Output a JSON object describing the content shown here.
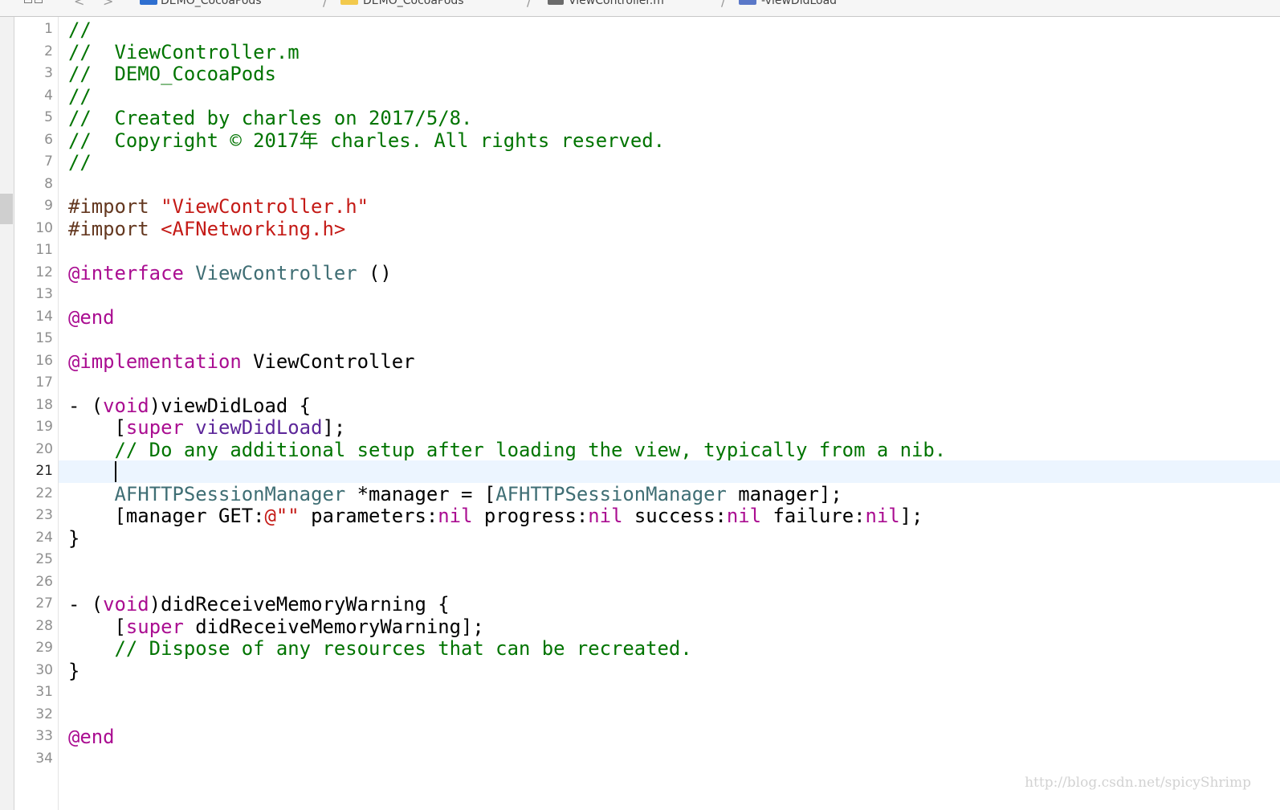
{
  "jumpbar": {
    "crumbs": [
      "DEMO_CocoaPods",
      "DEMO_CocoaPods",
      "ViewController.m",
      "-viewDidLoad"
    ],
    "separator": "/",
    "back_arrow": "<",
    "forward_arrow": ">",
    "icons": [
      "grid-icon",
      "project-file-icon",
      "folder-icon",
      "objc-source-file-icon",
      "method-icon"
    ]
  },
  "editor": {
    "filename": "ViewController.m",
    "current_line": 21,
    "colors": {
      "comment": "#007400",
      "preprocessor": "#643820",
      "string": "#c41a16",
      "keyword": "#aa0d91",
      "class": "#3f6e74",
      "library_method": "#5c2699",
      "current_line_bg": "#ecf5ff"
    },
    "line_numbers": [
      "1",
      "2",
      "3",
      "4",
      "5",
      "6",
      "7",
      "8",
      "9",
      "10",
      "11",
      "12",
      "13",
      "14",
      "15",
      "16",
      "17",
      "18",
      "19",
      "20",
      "21",
      "22",
      "23",
      "24",
      "25",
      "26",
      "27",
      "28",
      "29",
      "30",
      "31",
      "32",
      "33",
      "34"
    ],
    "lines": [
      [
        {
          "t": "comment",
          "s": "//"
        }
      ],
      [
        {
          "t": "comment",
          "s": "//  ViewController.m"
        }
      ],
      [
        {
          "t": "comment",
          "s": "//  DEMO_CocoaPods"
        }
      ],
      [
        {
          "t": "comment",
          "s": "//"
        }
      ],
      [
        {
          "t": "comment",
          "s": "//  Created by charles on 2017/5/8."
        }
      ],
      [
        {
          "t": "comment",
          "s": "//  Copyright © 2017年 charles. All rights reserved."
        }
      ],
      [
        {
          "t": "comment",
          "s": "//"
        }
      ],
      [],
      [
        {
          "t": "pre",
          "s": "#import "
        },
        {
          "t": "str",
          "s": "\"ViewController.h\""
        }
      ],
      [
        {
          "t": "pre",
          "s": "#import "
        },
        {
          "t": "str",
          "s": "<AFNetworking.h>"
        }
      ],
      [],
      [
        {
          "t": "kw",
          "s": "@interface"
        },
        {
          "t": "",
          "s": " "
        },
        {
          "t": "cls",
          "s": "ViewController"
        },
        {
          "t": "",
          "s": " ()"
        }
      ],
      [],
      [
        {
          "t": "kw",
          "s": "@end"
        }
      ],
      [],
      [
        {
          "t": "kw",
          "s": "@implementation"
        },
        {
          "t": "",
          "s": " ViewController"
        }
      ],
      [],
      [
        {
          "t": "",
          "s": "- ("
        },
        {
          "t": "kw",
          "s": "void"
        },
        {
          "t": "",
          "s": ")viewDidLoad {"
        }
      ],
      [
        {
          "t": "",
          "s": "    ["
        },
        {
          "t": "kw",
          "s": "super"
        },
        {
          "t": "",
          "s": " "
        },
        {
          "t": "lib",
          "s": "viewDidLoad"
        },
        {
          "t": "",
          "s": "];"
        }
      ],
      [
        {
          "t": "comment",
          "s": "    // Do any additional setup after loading the view, typically from a nib."
        }
      ],
      [],
      [
        {
          "t": "",
          "s": "    "
        },
        {
          "t": "cls",
          "s": "AFHTTPSessionManager"
        },
        {
          "t": "",
          "s": " *manager = ["
        },
        {
          "t": "cls",
          "s": "AFHTTPSessionManager"
        },
        {
          "t": "",
          "s": " manager];"
        }
      ],
      [
        {
          "t": "",
          "s": "    [manager GET:"
        },
        {
          "t": "str",
          "s": "@\"\""
        },
        {
          "t": "",
          "s": " parameters:"
        },
        {
          "t": "kw",
          "s": "nil"
        },
        {
          "t": "",
          "s": " progress:"
        },
        {
          "t": "kw",
          "s": "nil"
        },
        {
          "t": "",
          "s": " success:"
        },
        {
          "t": "kw",
          "s": "nil"
        },
        {
          "t": "",
          "s": " failure:"
        },
        {
          "t": "kw",
          "s": "nil"
        },
        {
          "t": "",
          "s": "];"
        }
      ],
      [
        {
          "t": "",
          "s": "}"
        }
      ],
      [],
      [],
      [
        {
          "t": "",
          "s": "- ("
        },
        {
          "t": "kw",
          "s": "void"
        },
        {
          "t": "",
          "s": ")didReceiveMemoryWarning {"
        }
      ],
      [
        {
          "t": "",
          "s": "    ["
        },
        {
          "t": "kw",
          "s": "super"
        },
        {
          "t": "",
          "s": " didReceiveMemoryWarning];"
        }
      ],
      [
        {
          "t": "comment",
          "s": "    // Dispose of any resources that can be recreated."
        }
      ],
      [
        {
          "t": "",
          "s": "}"
        }
      ],
      [],
      [],
      [
        {
          "t": "kw",
          "s": "@end"
        }
      ],
      []
    ]
  },
  "watermark": "http://blog.csdn.net/spicyShrimp"
}
